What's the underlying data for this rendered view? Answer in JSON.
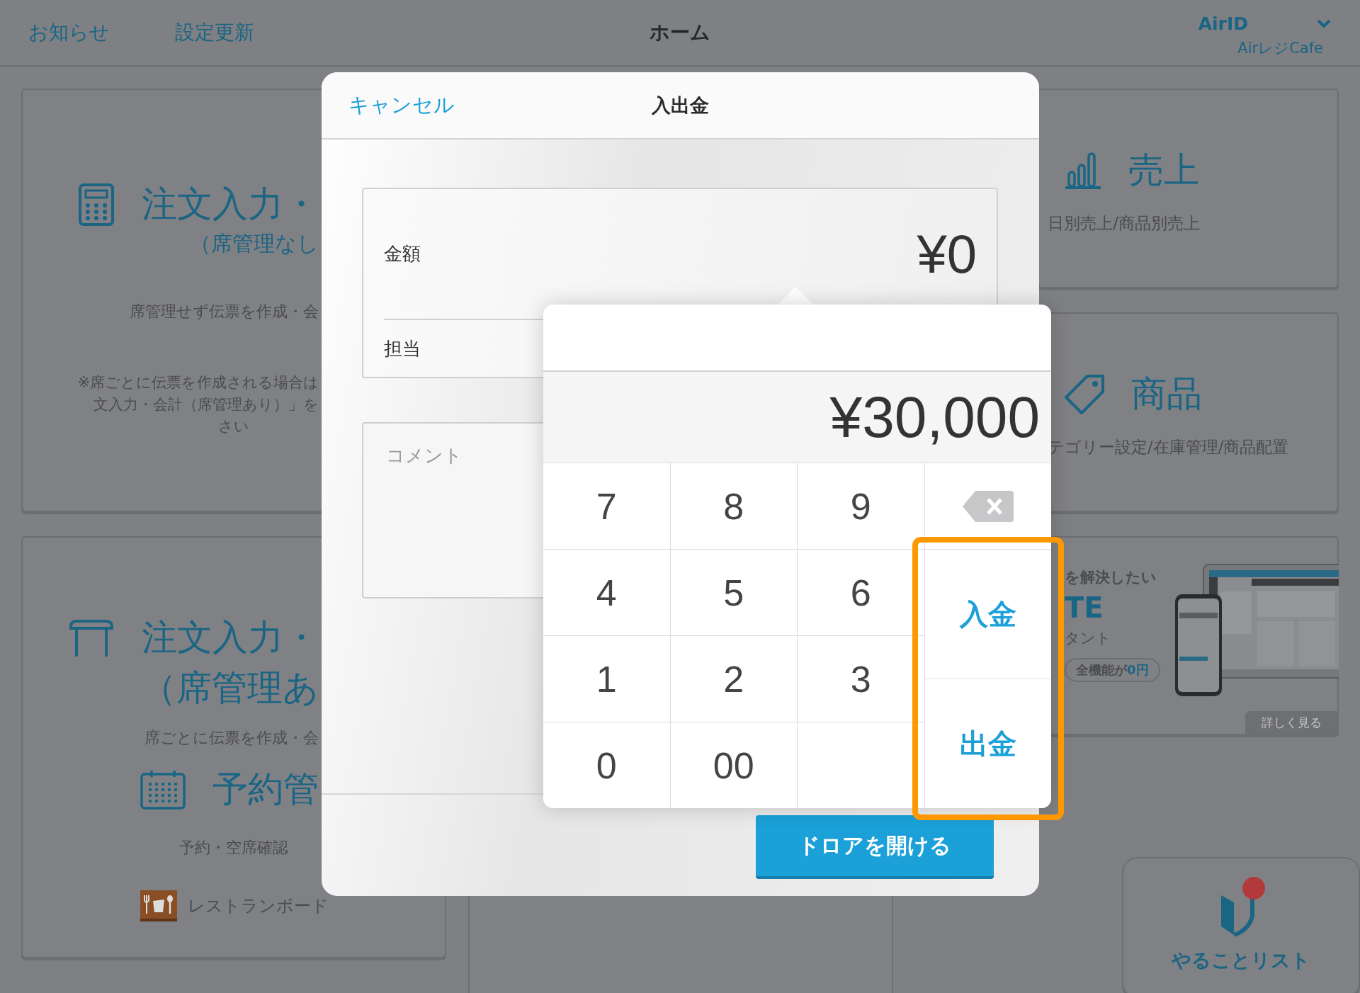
{
  "header": {
    "links": [
      {
        "label": "お知らせ"
      },
      {
        "label": "設定更新"
      }
    ],
    "title": "ホーム",
    "account": {
      "name": "AirID",
      "store": "AirレジCafe"
    }
  },
  "order_card": {
    "title": "注文入力・",
    "subtitle": "（席管理なし",
    "description": "席管理せず伝票を作成・会",
    "note": [
      "※席ごとに伝票を作成される場合は",
      "文入力・会計（席管理あり）」を",
      "さい"
    ]
  },
  "table_card": {
    "title": "注文入力・",
    "subtitle": "（席管理あ",
    "description": "席ごとに伝票を作成・会",
    "reservation_title": "予約管",
    "reservation_description": "予約・空席確認",
    "board_link": "レストランボード"
  },
  "sales_card": {
    "title": "売上",
    "description": "日別売上/商品別売上"
  },
  "products_card": {
    "title": "商品",
    "description": "テゴリー設定/在庫管理/商品配置"
  },
  "ad_banner": {
    "headline": "を解決したい",
    "brand": "TE",
    "tagline": "タント",
    "pill_text": "全機能が",
    "pill_highlight": "0円",
    "button": "詳しく見る"
  },
  "todo_card": {
    "label": "やることリスト"
  },
  "dialog": {
    "cancel": "キャンセル",
    "title": "入出金",
    "amount_label": "金額",
    "amount_value": "¥0",
    "staff_label": "担当",
    "comment_placeholder": "コメント",
    "drawer_button": "ドロアを開ける"
  },
  "keypad": {
    "display": "¥30,000",
    "rows": [
      [
        "7",
        "8",
        "9"
      ],
      [
        "4",
        "5",
        "6"
      ],
      [
        "1",
        "2",
        "3"
      ],
      [
        "0",
        "00"
      ]
    ],
    "deposit": "入金",
    "withdraw": "出金"
  }
}
